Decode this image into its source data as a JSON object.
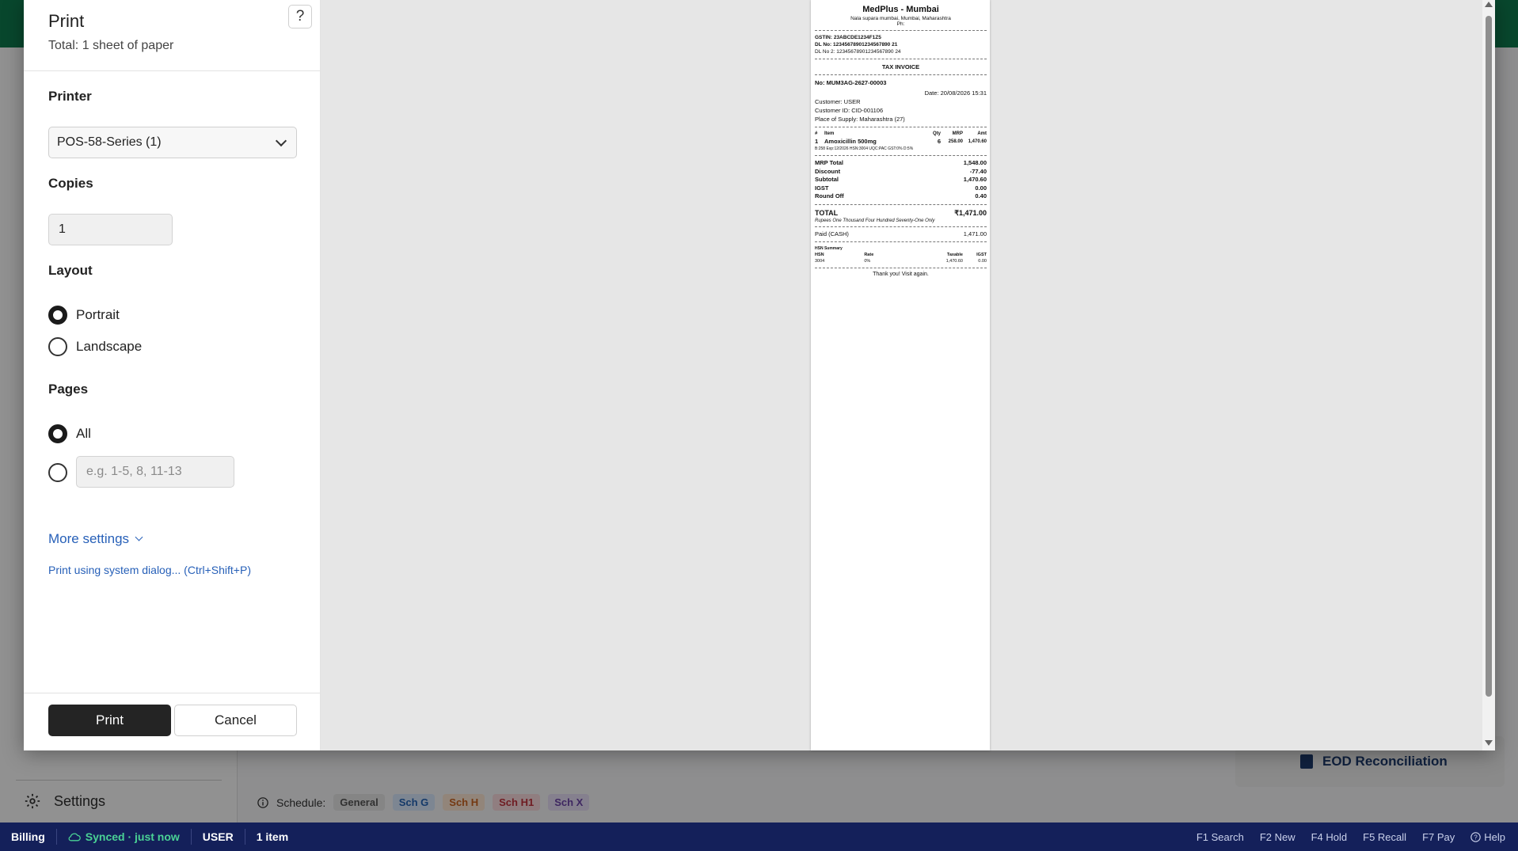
{
  "background": {
    "settings_label": "Settings",
    "schedule_label": "Schedule:",
    "schedule_chips": [
      {
        "label": "General",
        "bg": "#e5e5e5",
        "fg": "#555555"
      },
      {
        "label": "Sch G",
        "bg": "#d7e7fb",
        "fg": "#2463b5"
      },
      {
        "label": "Sch H",
        "bg": "#fbe5d3",
        "fg": "#c9631f"
      },
      {
        "label": "Sch H1",
        "bg": "#f9d9dc",
        "fg": "#c0313c"
      },
      {
        "label": "Sch X",
        "bg": "#e6dcf4",
        "fg": "#6c44a8"
      }
    ],
    "eod_label": "EOD Reconciliation"
  },
  "statusbar": {
    "mode": "Billing",
    "sync_status": "Synced · just now",
    "user": "USER",
    "items": "1 item",
    "shortcuts": [
      "F1 Search",
      "F2 New",
      "F4 Hold",
      "F5 Recall",
      "F7 Pay",
      "Help"
    ]
  },
  "dialog": {
    "title": "Print",
    "subtitle": "Total: 1 sheet of paper",
    "help_symbol": "?",
    "printer_label": "Printer",
    "printer_value": "POS-58-Series (1)",
    "copies_label": "Copies",
    "copies_value": "1",
    "layout_label": "Layout",
    "layout_options": [
      {
        "label": "Portrait",
        "selected": true
      },
      {
        "label": "Landscape",
        "selected": false
      }
    ],
    "pages_label": "Pages",
    "pages_all_label": "All",
    "pages_custom_placeholder": "e.g. 1-5, 8, 11-13",
    "more_settings_label": "More settings",
    "system_dialog_label": "Print using system dialog... (Ctrl+Shift+P)",
    "print_button": "Print",
    "cancel_button": "Cancel"
  },
  "receipt": {
    "store_name": "MedPlus - Mumbai",
    "address": "Nala supara mumbai, Mumbai, Maharashtra",
    "phone": "Ph:",
    "gstin": "GSTIN: 23ABCDE1234F1Z5",
    "dl_no": "DL No: 12345678901234567890 21",
    "dl_no2": "DL No 2: 12345678901234567890 24",
    "doc_type": "TAX INVOICE",
    "invoice_no": "No: MUM3AG-2627-00003",
    "date": "Date: 20/08/2026 15:31",
    "customer": "Customer: USER",
    "customer_id": "Customer ID: CID-001106",
    "place_of_supply": "Place of Supply: Maharashtra (27)",
    "item_headers": [
      "#",
      "Item",
      "Qty",
      "MRP",
      "Amt"
    ],
    "items": [
      {
        "no": "1",
        "name": "Amoxicillin 500mg",
        "qty": "6",
        "mrp": "258.00",
        "amt": "1,470.60"
      }
    ],
    "item_detail": "B:258 Exp:12/2026 HSN:3004 UQC:PAC GST:0% D:5%",
    "totals": [
      {
        "label": "MRP Total",
        "value": "1,548.00"
      },
      {
        "label": "Discount",
        "value": "-77.40"
      },
      {
        "label": "Subtotal",
        "value": "1,470.60"
      },
      {
        "label": "IGST",
        "value": "0.00"
      },
      {
        "label": "Round Off",
        "value": "0.40"
      }
    ],
    "total_label": "TOTAL",
    "total_value": "₹1,471.00",
    "amount_words": "Rupees One Thousand Four Hundred Seventy-One Only",
    "paid_label": "Paid (CASH)",
    "paid_value": "1,471.00",
    "hsn_title": "HSN Summary",
    "hsn_headers": [
      "HSN",
      "Rate",
      "Taxable",
      "IGST"
    ],
    "hsn_rows": [
      [
        "3004",
        "0%",
        "1,470.60",
        "0.00"
      ]
    ],
    "thanks": "Thank you! Visit again."
  }
}
